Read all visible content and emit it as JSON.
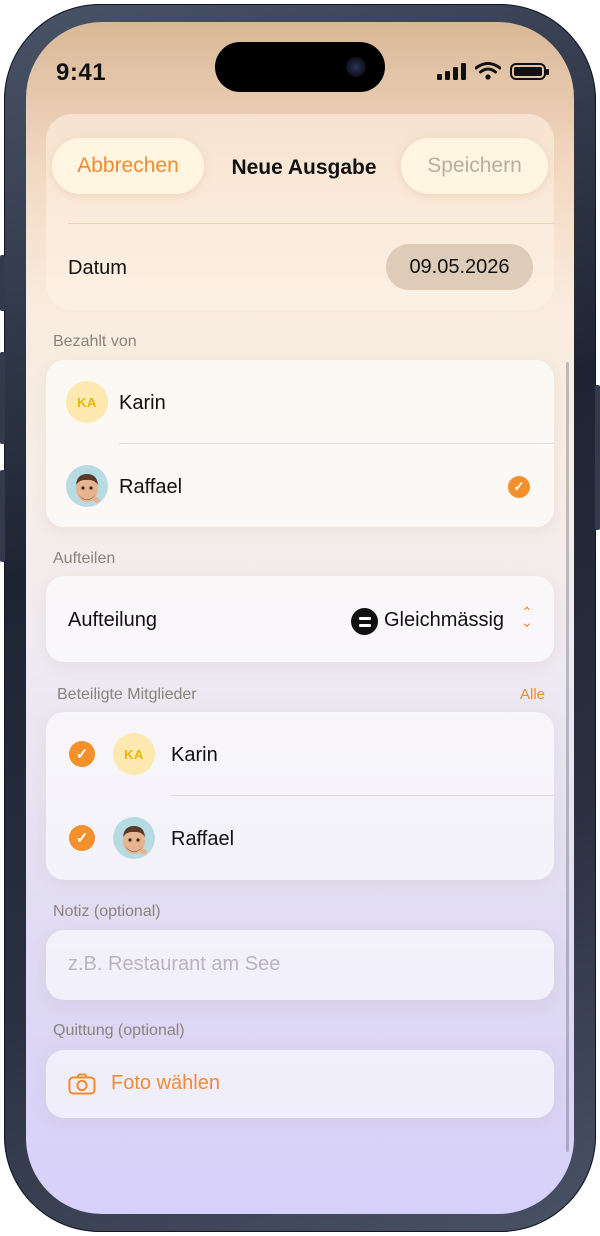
{
  "status_bar": {
    "time": "9:41"
  },
  "nav": {
    "cancel_label": "Abbrechen",
    "title": "Neue Ausgabe",
    "save_label": "Speichern"
  },
  "date_row": {
    "label": "Datum",
    "value": "09.05.2026"
  },
  "paid_by": {
    "header": "Bezahlt von",
    "people": [
      {
        "initials": "KA",
        "name": "Karin",
        "selected": false
      },
      {
        "initials": "",
        "name": "Raffael",
        "selected": true
      }
    ]
  },
  "split": {
    "header": "Aufteilen",
    "label": "Aufteilung",
    "value": "Gleichmässig"
  },
  "members": {
    "header": "Beteiligte Mitglieder",
    "all_label": "Alle",
    "people": [
      {
        "initials": "KA",
        "name": "Karin",
        "checked": true
      },
      {
        "initials": "",
        "name": "Raffael",
        "checked": true
      }
    ]
  },
  "note": {
    "header": "Notiz (optional)",
    "placeholder": "z.B. Restaurant am See"
  },
  "receipt": {
    "header": "Quittung (optional)",
    "button_label": "Foto wählen"
  },
  "colors": {
    "accent": "#F4902C",
    "avatar_ka_bg": "#FDE8B0",
    "avatar_ka_text": "#E7B800"
  }
}
